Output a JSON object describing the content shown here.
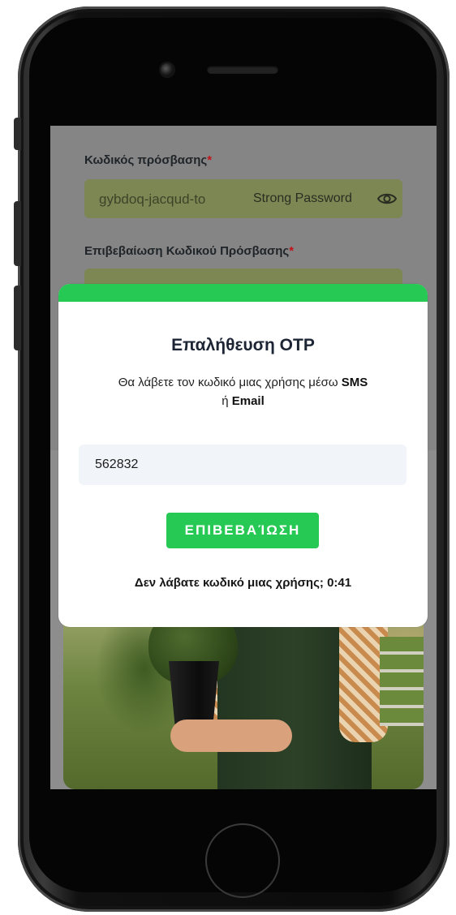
{
  "form": {
    "password_label": "Κωδικός πρόσβασης",
    "password_value": "gybdoq-jacqud-to",
    "password_strength": "Strong Password",
    "confirm_password_label": "Επιβεβαίωση Κωδικού Πρόσβασης",
    "required_mark": "*"
  },
  "modal": {
    "title": "Επαλήθευση OTP",
    "description_prefix": "Θα λάβετε τον κωδικό μιας χρήσης μέσω",
    "description_sms": "SMS",
    "description_or": "ή",
    "description_email": "Email",
    "otp_value": "562832",
    "confirm_label": "ΕΠΙΒΕΒΑΊΩΣΗ",
    "resend_prefix": "Δεν λάβατε κωδικό μιας χρήσης;",
    "countdown": "0:41"
  },
  "colors": {
    "accent_green": "#27c955",
    "title_navy": "#1d2534",
    "required_red": "#c0141a"
  },
  "icons": {
    "password_visibility": "eye-icon"
  }
}
